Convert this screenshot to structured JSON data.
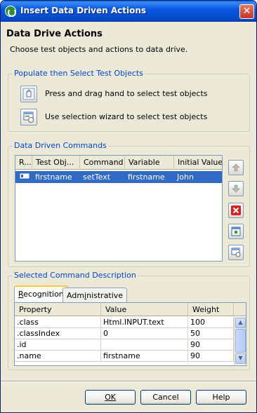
{
  "window": {
    "title": "Insert Data Driven Actions",
    "close_label": "✕"
  },
  "header": {
    "title": "Data Drive Actions",
    "subtitle": "Choose test objects and actions to data drive."
  },
  "populate_group": {
    "title": "Populate then Select Test Objects",
    "hand_label": "Press and drag hand to select test objects",
    "wizard_label": "Use selection wizard to select test objects"
  },
  "commands_group": {
    "title": "Data Driven Commands",
    "columns": [
      "R...",
      "Test Obj...",
      "Command",
      "Variable",
      "Initial Value"
    ],
    "rows": [
      {
        "test_object": "firstname",
        "command": "setText",
        "variable": "firstname",
        "initial_value": "John"
      }
    ]
  },
  "description_group": {
    "title": "Selected Command Description",
    "tabs": [
      {
        "label": "Recognition",
        "accel": "R"
      },
      {
        "label": "Administrative",
        "accel": "i"
      }
    ],
    "columns": [
      "Property",
      "Value",
      "Weight"
    ],
    "rows": [
      {
        "property": ".class",
        "value": "Html.INPUT.text",
        "weight": "100"
      },
      {
        "property": ".classIndex",
        "value": "0",
        "weight": "50"
      },
      {
        "property": ".id",
        "value": "",
        "weight": "90"
      },
      {
        "property": ".name",
        "value": "firstname",
        "weight": "90"
      }
    ]
  },
  "buttons": {
    "ok": "OK",
    "cancel": "Cancel",
    "help": "Help"
  },
  "colors": {
    "titlebar": "#0858E0",
    "group_title": "#0046D5",
    "selection": "#316AC5",
    "delete_icon": "#D92020"
  }
}
